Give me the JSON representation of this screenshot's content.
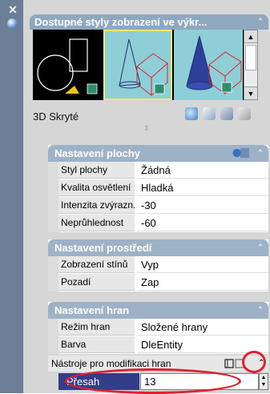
{
  "palette": {
    "close_glyph": "✕",
    "auto_hide_icon": "auto-hide-icon"
  },
  "styles_panel": {
    "title": "Dostupné styly zobrazení ve výkr...",
    "collapse_glyph": "⌃",
    "current_style": "3D Skryté",
    "thumbnails": [
      {
        "name": "2d-wireframe",
        "selected": false
      },
      {
        "name": "3d-hidden",
        "selected": true
      },
      {
        "name": "3d-wireframe",
        "selected": false
      }
    ],
    "tools": [
      "create-style-icon",
      "apply-style-icon",
      "export-icon",
      "delete-icon"
    ],
    "scroll_up": "▲",
    "scroll_down": "▼"
  },
  "sections": {
    "plocha": {
      "title": "Nastavení plochy",
      "rows": [
        {
          "label": "Styl plochy",
          "value": "Žádná"
        },
        {
          "label": "Kvalita osvětlení",
          "value": "Hladká"
        },
        {
          "label": "Intenzita zvýrazn...",
          "value": "-30"
        },
        {
          "label": "Neprůhlednost",
          "value": "-60"
        }
      ]
    },
    "prostredi": {
      "title": "Nastavení prostředí",
      "rows": [
        {
          "label": "Zobrazení stínů",
          "value": "Vyp"
        },
        {
          "label": "Pozadí",
          "value": "Zap"
        }
      ]
    },
    "hrany": {
      "title": "Nastavení hran",
      "rows": [
        {
          "label": "Režim hran",
          "value": "Složené hrany"
        },
        {
          "label": "Barva",
          "value": "DleEntity"
        }
      ]
    }
  },
  "edge_tools": {
    "title": "Nástroje pro modifikaci hran",
    "collapse_glyph": "⌃",
    "icon": "edge-modifier-icon"
  },
  "presah": {
    "label": "Přesah",
    "value": "13",
    "spin_up": "▲",
    "spin_down": "▼"
  },
  "colors": {
    "titlebar": "#6c7f96",
    "header": "#9eb2c7",
    "selected_row": "#343d87",
    "highlight": "#e0202c",
    "thumb_bg": "#8ecfd7",
    "selected_border": "#f2e86a"
  }
}
